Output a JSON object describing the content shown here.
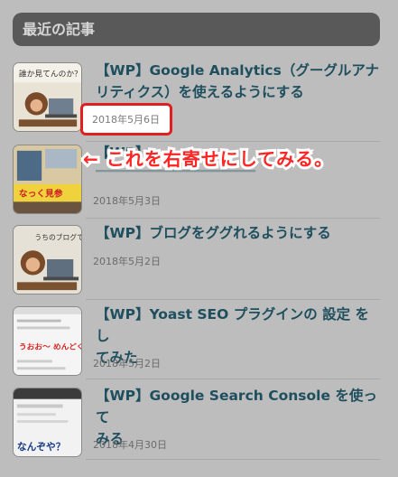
{
  "widget": {
    "title": "最近の記事"
  },
  "posts": [
    {
      "title_line1": "【WP】Google Analytics（グーグルアナ",
      "title_line2": "リティクス）を使えるようにする",
      "date": "2018年5月6日",
      "thumb_text": "誰か見てんのか？",
      "thumb_icon": "monkey-laptop-icon"
    },
    {
      "title_line1": "【WP】",
      "title_line2": "",
      "date": "2018年5月3日",
      "thumb_text": "なっく見参",
      "thumb_icon": "welcome-banner-icon"
    },
    {
      "title_line1": "【WP】ブログをググれるようにする",
      "title_line2": "",
      "date": "2018年5月2日",
      "thumb_text": "うちのブログでてこねぇ？",
      "thumb_icon": "monkey-laptop-icon"
    },
    {
      "title_line1": "【WP】Yoast SEO プラグインの 設定 をし",
      "title_line2": "てみた",
      "date": "2018年5月2日",
      "thumb_text": "うおお〜 めんどくせぇ！",
      "thumb_icon": "screenshot-settings-icon"
    },
    {
      "title_line1": "【WP】Google Search Console を使って",
      "title_line2": "みる",
      "date": "2018年4月30日",
      "thumb_text": "なんぞや？",
      "thumb_icon": "search-console-screenshot-icon"
    }
  ],
  "annotation": {
    "text": "← これを右寄せにしてみる。"
  },
  "colors": {
    "highlight": "#e02020",
    "title": "#1f4f5e",
    "background": "#bdbdbd"
  }
}
